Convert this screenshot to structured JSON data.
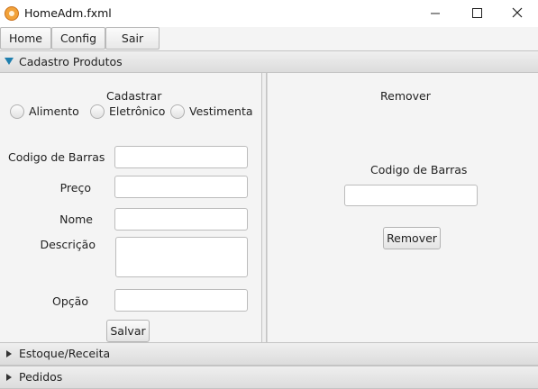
{
  "window": {
    "title": "HomeAdm.fxml",
    "app_icon": "javafx-app-icon",
    "controls": {
      "minimize": "─",
      "maximize": "☐",
      "close": "✕"
    }
  },
  "menu": {
    "home": "Home",
    "config": "Config",
    "sair": "Sair"
  },
  "accordion": {
    "cadastro": {
      "title": "Cadastro Produtos",
      "expanded": true,
      "arrow_color": "#1f7fae"
    },
    "estoque": {
      "title": "Estoque/Receita",
      "expanded": false
    },
    "pedidos": {
      "title": "Pedidos",
      "expanded": false
    }
  },
  "cadastrar": {
    "heading": "Cadastrar",
    "radios": [
      "Alimento",
      "Eletrônico",
      "Vestimenta"
    ],
    "fields": {
      "codigo_label": "Codigo de Barras",
      "preco_label": "Preço",
      "nome_label": "Nome",
      "descricao_label": "Descrição",
      "opcao_label": "Opção"
    },
    "save_label": "Salvar"
  },
  "remover": {
    "heading": "Remover",
    "codigo_label": "Codigo de Barras",
    "button_label": "Remover"
  }
}
